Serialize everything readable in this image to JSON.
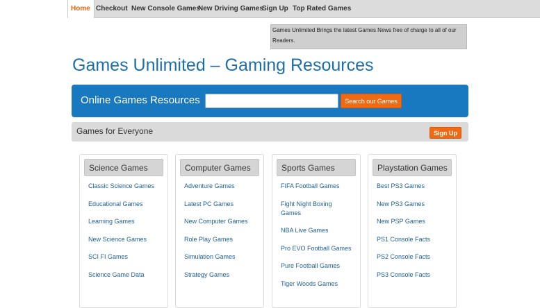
{
  "nav": {
    "items": [
      {
        "label": "Home",
        "active": true
      },
      {
        "label": "Checkout",
        "active": false
      },
      {
        "label": "New Console Games",
        "active": false
      },
      {
        "label": "New Driving Games",
        "active": false
      },
      {
        "label": "Sign Up",
        "active": false
      },
      {
        "label": "Top Rated Games",
        "active": false
      }
    ]
  },
  "notice": {
    "text": "Games Unlimited Brings the latest Games News free of charge to all of our Readers."
  },
  "header": {
    "title": "Games Unlimited – Gaming Resources"
  },
  "search": {
    "label": "Online Games Resources",
    "value": "",
    "button_label": "Search our Games"
  },
  "banner": {
    "text": "Games for Everyone",
    "signup_label": "Sign Up"
  },
  "columns": [
    {
      "title": "Science Games",
      "links": [
        "Classic Science Games",
        "Educational Games",
        "Learning Games",
        "New Science Games",
        "SCI FI Games",
        "Science Game Data"
      ]
    },
    {
      "title": "Computer Games",
      "links": [
        "Adventure Games",
        "Latest PC Games",
        "New Computer Games",
        "Role Play Games",
        "Simulation Games",
        "Strategy Games"
      ]
    },
    {
      "title": "Sports Games",
      "links": [
        "FIFA Football Games",
        "Fight Night Boxing Games",
        "NBA Live Games",
        "Pro EVO Football Games",
        "Pure Football Games",
        "Tiger Woods Games"
      ]
    },
    {
      "title": "Playstation Games",
      "links": [
        "Best PS3 Games",
        "New PS3 Games",
        "New PSP Games",
        "PS1 Console Facts",
        "PS2 Console Facts",
        "PS3 Console Facts"
      ]
    }
  ],
  "colors": {
    "accent": "#ef6a13",
    "brand_blue": "#1878c0",
    "title_blue": "#1f6fa8",
    "link_blue": "#1d5f97"
  }
}
